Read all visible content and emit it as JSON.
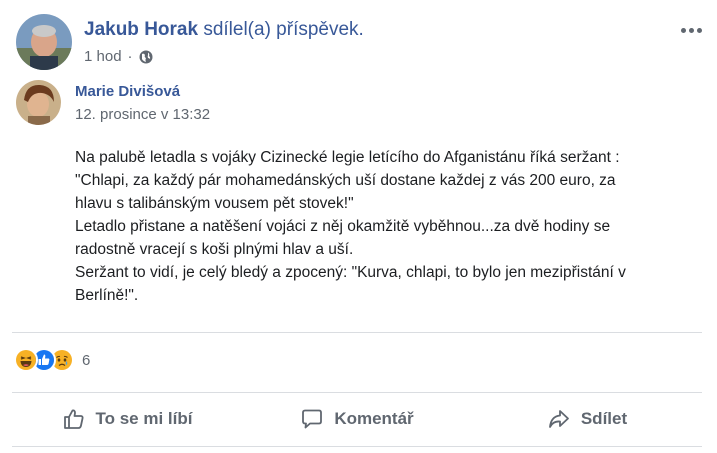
{
  "header": {
    "author_name": "Jakub Horak",
    "shared_text": "sdílel(a) příspěvek.",
    "time": "1 hod",
    "privacy_icon": "globe-icon",
    "menu_icon": "more-horizontal-icon"
  },
  "shared_post": {
    "author_name": "Marie Divišová",
    "date": "12. prosince v 13:32"
  },
  "body": {
    "lines": [
      "Na palubě letadla s vojáky Cizinecké legie letícího do Afganistánu říká seržant :",
      "\"Chlapi, za každý pár mohamedánských uší dostane každej z vás 200 euro, za",
      "hlavu s talibánským vousem pět stovek!\"",
      "Letadlo přistane a natěšení vojáci z něj okamžitě vyběhnou...za dvě hodiny se",
      "radostně vracejí s koši plnými hlav a uší.",
      "Seržant to vidí, je celý bledý a zpocený: \"Kurva, chlapi, to bylo jen mezipřistání v",
      "Berlíně!\"."
    ]
  },
  "reactions": {
    "icons": [
      "haha-icon",
      "like-icon",
      "sad-icon"
    ],
    "count": "6"
  },
  "actions": {
    "like_label": "To se mi líbí",
    "comment_label": "Komentář",
    "share_label": "Sdílet"
  },
  "colors": {
    "link": "#385898",
    "meta": "#606770",
    "like_blue": "#1877f2",
    "emoji_yellow": "#f7b125"
  }
}
